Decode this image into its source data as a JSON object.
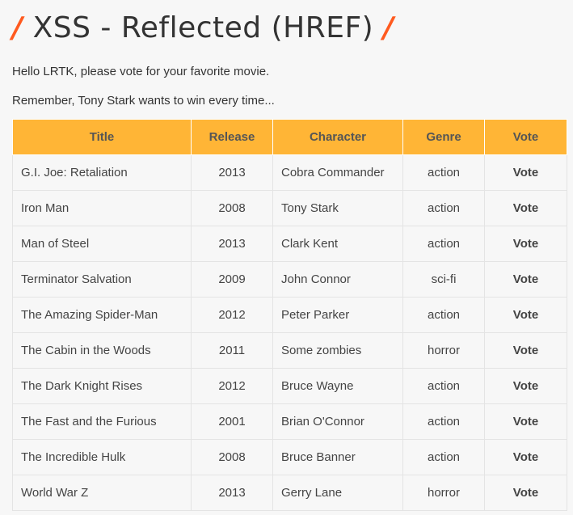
{
  "header": {
    "title": "XSS - Reflected (HREF)",
    "slash": "/"
  },
  "messages": {
    "greeting": "Hello LRTK, please vote for your favorite movie.",
    "note": "Remember, Tony Stark wants to win every time..."
  },
  "table": {
    "columns": [
      "Title",
      "Release",
      "Character",
      "Genre",
      "Vote"
    ],
    "rows": [
      {
        "title": "G.I. Joe: Retaliation",
        "release": "2013",
        "character": "Cobra Commander",
        "genre": "action",
        "vote": "Vote"
      },
      {
        "title": "Iron Man",
        "release": "2008",
        "character": "Tony Stark",
        "genre": "action",
        "vote": "Vote"
      },
      {
        "title": "Man of Steel",
        "release": "2013",
        "character": "Clark Kent",
        "genre": "action",
        "vote": "Vote"
      },
      {
        "title": "Terminator Salvation",
        "release": "2009",
        "character": "John Connor",
        "genre": "sci-fi",
        "vote": "Vote"
      },
      {
        "title": "The Amazing Spider-Man",
        "release": "2012",
        "character": "Peter Parker",
        "genre": "action",
        "vote": "Vote"
      },
      {
        "title": "The Cabin in the Woods",
        "release": "2011",
        "character": "Some zombies",
        "genre": "horror",
        "vote": "Vote"
      },
      {
        "title": "The Dark Knight Rises",
        "release": "2012",
        "character": "Bruce Wayne",
        "genre": "action",
        "vote": "Vote"
      },
      {
        "title": "The Fast and the Furious",
        "release": "2001",
        "character": "Brian O'Connor",
        "genre": "action",
        "vote": "Vote"
      },
      {
        "title": "The Incredible Hulk",
        "release": "2008",
        "character": "Bruce Banner",
        "genre": "action",
        "vote": "Vote"
      },
      {
        "title": "World War Z",
        "release": "2013",
        "character": "Gerry Lane",
        "genre": "horror",
        "vote": "Vote"
      }
    ]
  },
  "colors": {
    "accent": "#ff5a1f",
    "table_header": "#ffb536",
    "background": "#f7f7f7"
  }
}
